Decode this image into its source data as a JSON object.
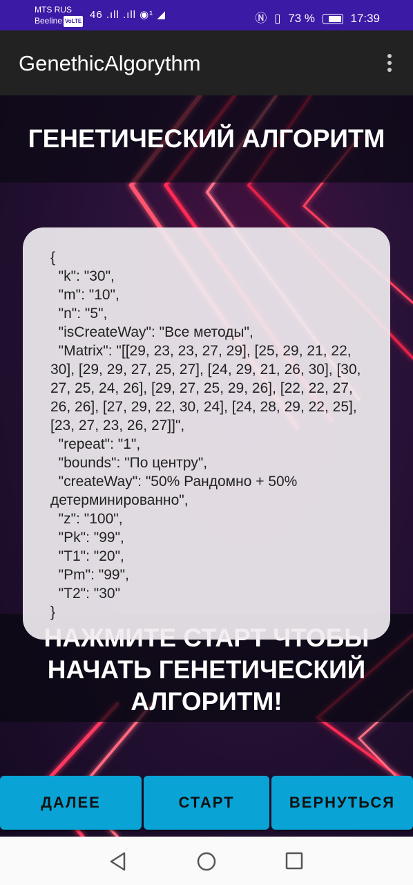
{
  "status_bar": {
    "carrier1": "MTS RUS",
    "carrier2": "Beeline",
    "volte": "VoLTE",
    "signal_icons": "46 .ıll .ıll ◉¹ ◢",
    "battery": "73 %",
    "time": "17:39"
  },
  "app_bar": {
    "title": "GenethicAlgorythm"
  },
  "main": {
    "heading": "ГЕНЕТИЧЕСКИЙ АЛГОРИТМ",
    "params_json": "{\n  \"k\": \"30\",\n  \"m\": \"10\",\n  \"n\": \"5\",\n  \"isCreateWay\": \"Все методы\",\n  \"Matrix\": \"[[29, 23, 23, 27, 29], [25, 29, 21, 22, 30], [29, 29, 27, 25, 27], [24, 29, 21, 26, 30], [30, 27, 25, 24, 26], [29, 27, 25, 29, 26], [22, 22, 27, 26, 26], [27, 29, 22, 30, 24], [24, 28, 29, 22, 25], [23, 27, 23, 26, 27]]\",\n  \"repeat\": \"1\",\n  \"bounds\": \"По центру\",\n  \"createWay\": \"50% Рандомно + 50% детерминированно\",\n  \"z\": \"100\",\n  \"Pk\": \"99\",\n  \"T1\": \"20\",\n  \"Pm\": \"99\",\n  \"T2\": \"30\"\n}",
    "message": "НАЖМИТЕ СТАРТ ЧТОБЫ НАЧАТЬ ГЕНЕТИЧЕСКИЙ АЛГОРИТМ!"
  },
  "buttons": {
    "next": "ДАЛЕЕ",
    "start": "СТАРТ",
    "back": "ВЕРНУТЬСЯ"
  },
  "colors": {
    "status_bar": "#3b1aa6",
    "app_bar": "#222222",
    "button": "#0aa3d6"
  }
}
